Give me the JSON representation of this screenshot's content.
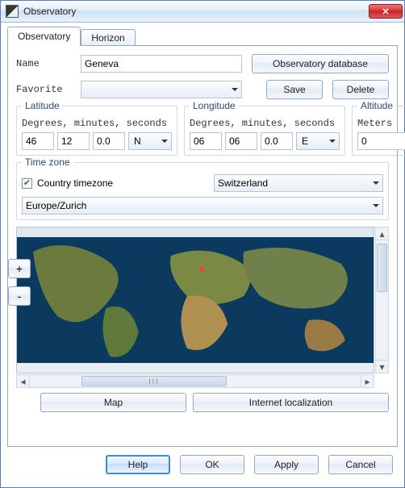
{
  "window": {
    "title": "Observatory"
  },
  "tabs": {
    "observatory": "Observatory",
    "horizon": "Horizon"
  },
  "fields": {
    "name_label": "Name",
    "name_value": "Geneva",
    "favorite_label": "Favorite",
    "favorite_value": ""
  },
  "buttons": {
    "database": "Observatory database",
    "save": "Save",
    "delete": "Delete",
    "map": "Map",
    "internet": "Internet localization",
    "help": "Help",
    "ok": "OK",
    "apply": "Apply",
    "cancel": "Cancel",
    "zoom_in": "+",
    "zoom_out": "-"
  },
  "latitude": {
    "legend": "Latitude",
    "sublabel": "Degrees, minutes, seconds",
    "deg": "46",
    "min": "12",
    "sec": "0.0",
    "hemi": "N"
  },
  "longitude": {
    "legend": "Longitude",
    "sublabel": "Degrees, minutes, seconds",
    "deg": "06",
    "min": "06",
    "sec": "0.0",
    "hemi": "E"
  },
  "altitude": {
    "legend": "Altitude",
    "sublabel": "Meters",
    "value": "0"
  },
  "timezone": {
    "legend": "Time zone",
    "checkbox_label": "Country timezone",
    "checked": true,
    "country": "Switzerland",
    "zone": "Europe/Zurich"
  },
  "scroll_grip": "III"
}
